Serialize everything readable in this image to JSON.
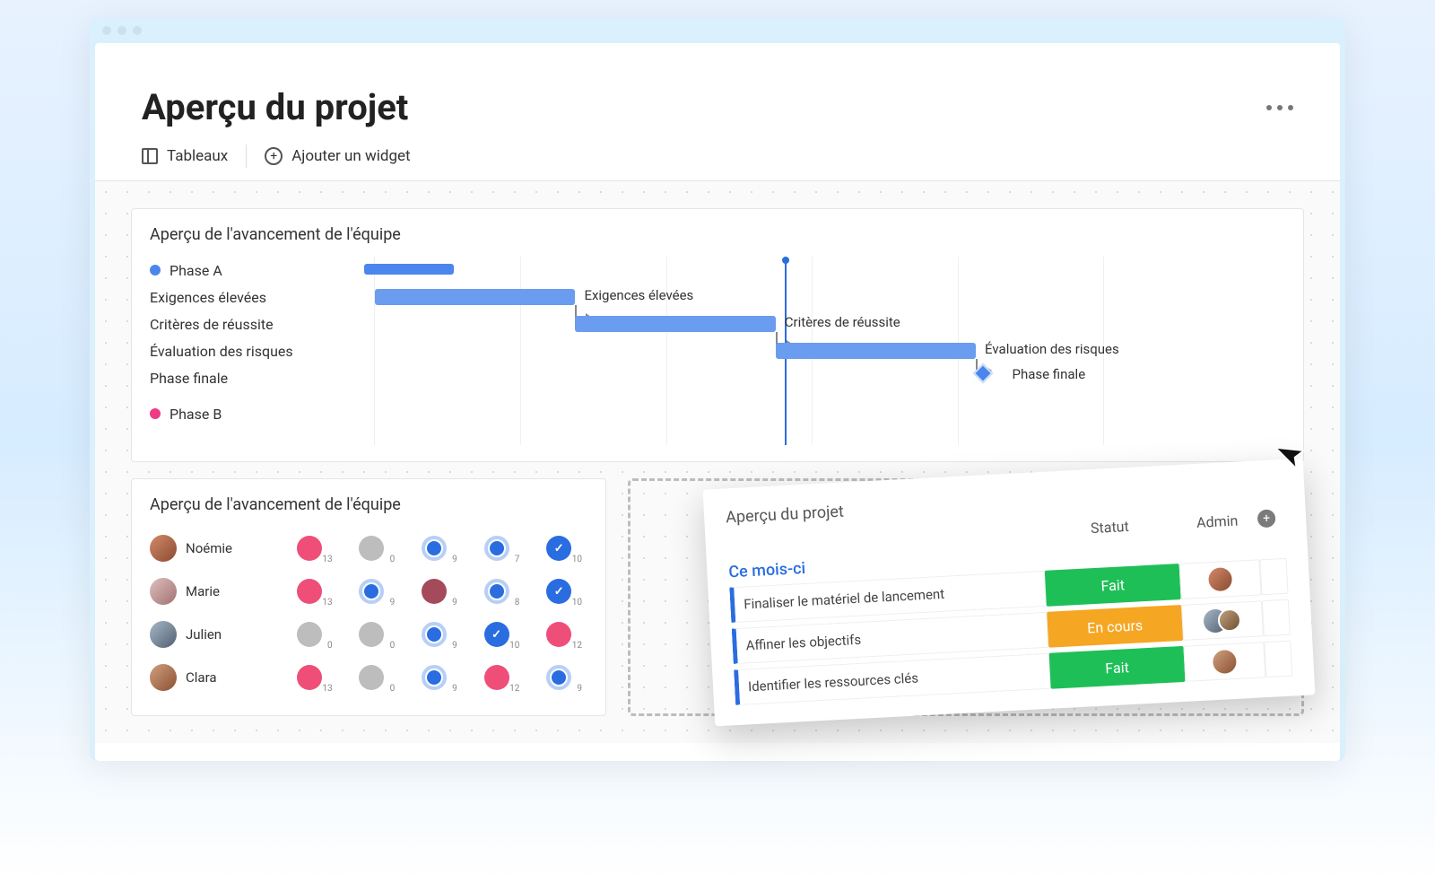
{
  "page": {
    "title": "Aperçu du projet"
  },
  "toolbar": {
    "tableaux_label": "Tableaux",
    "add_widget_label": "Ajouter un widget"
  },
  "gantt": {
    "title": "Aperçu de l'avancement de l'équipe",
    "phase_a": "Phase A",
    "phase_b": "Phase B",
    "rows": {
      "0": "Exigences élevées",
      "1": "Critères de réussite",
      "2": "Évaluation des risques",
      "3": "Phase finale"
    },
    "bar_labels": {
      "0": "Exigences élevées",
      "1": "Critères de réussite",
      "2": "Évaluation des risques",
      "3": "Phase finale"
    }
  },
  "team": {
    "title": "Aperçu de l'avancement de l'équipe",
    "members": {
      "0": {
        "name": "Noémie",
        "counts": [
          "13",
          "0",
          "9",
          "7",
          "10"
        ]
      },
      "1": {
        "name": "Marie",
        "counts": [
          "13",
          "9",
          "9",
          "8",
          "10"
        ]
      },
      "2": {
        "name": "Julien",
        "counts": [
          "0",
          "0",
          "9",
          "10",
          "12"
        ]
      },
      "3": {
        "name": "Clara",
        "counts": [
          "13",
          "0",
          "9",
          "12",
          "9"
        ]
      }
    }
  },
  "floating": {
    "title": "Aperçu du projet",
    "col_status": "Statut",
    "col_admin": "Admin",
    "month_label": "Ce mois-ci",
    "tasks": {
      "0": {
        "name": "Finaliser le matériel de lancement",
        "status": "Fait"
      },
      "1": {
        "name": "Affiner les objectifs",
        "status": "En cours"
      },
      "2": {
        "name": "Identifier les ressources clés",
        "status": "Fait"
      }
    }
  }
}
